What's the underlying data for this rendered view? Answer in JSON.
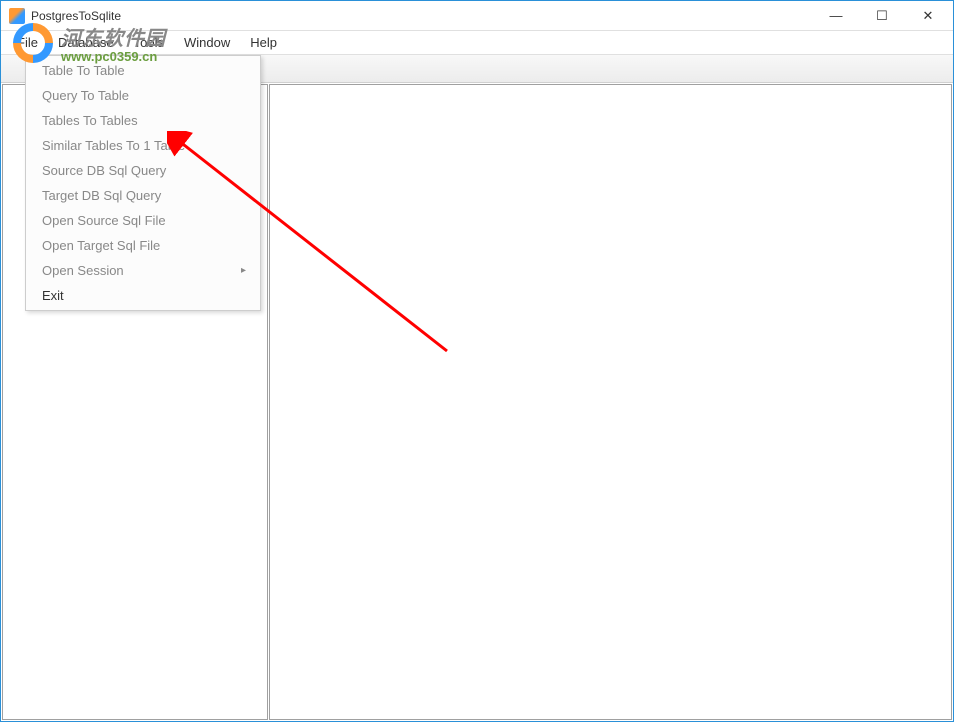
{
  "window": {
    "title": "PostgresToSqlite"
  },
  "menubar": {
    "items": [
      "File",
      "Database",
      "Tools",
      "Window",
      "Help"
    ]
  },
  "dropdown": {
    "items": [
      {
        "label": "Table To Table",
        "hasSubmenu": false
      },
      {
        "label": "Query To Table",
        "hasSubmenu": false
      },
      {
        "label": "Tables To Tables",
        "hasSubmenu": false
      },
      {
        "label": "Similar Tables To 1 Table",
        "hasSubmenu": false
      },
      {
        "label": "Source DB Sql Query",
        "hasSubmenu": false
      },
      {
        "label": "Target DB Sql Query",
        "hasSubmenu": false
      },
      {
        "label": "Open Source Sql File",
        "hasSubmenu": false
      },
      {
        "label": "Open Target Sql File",
        "hasSubmenu": false
      },
      {
        "label": "Open Session",
        "hasSubmenu": true
      },
      {
        "label": "Exit",
        "hasSubmenu": false,
        "enabled": true
      }
    ]
  },
  "watermark": {
    "cn": "河东软件园",
    "url": "www.pc0359.cn"
  },
  "winControls": {
    "minimize": "—",
    "maximize": "☐",
    "close": "✕"
  }
}
